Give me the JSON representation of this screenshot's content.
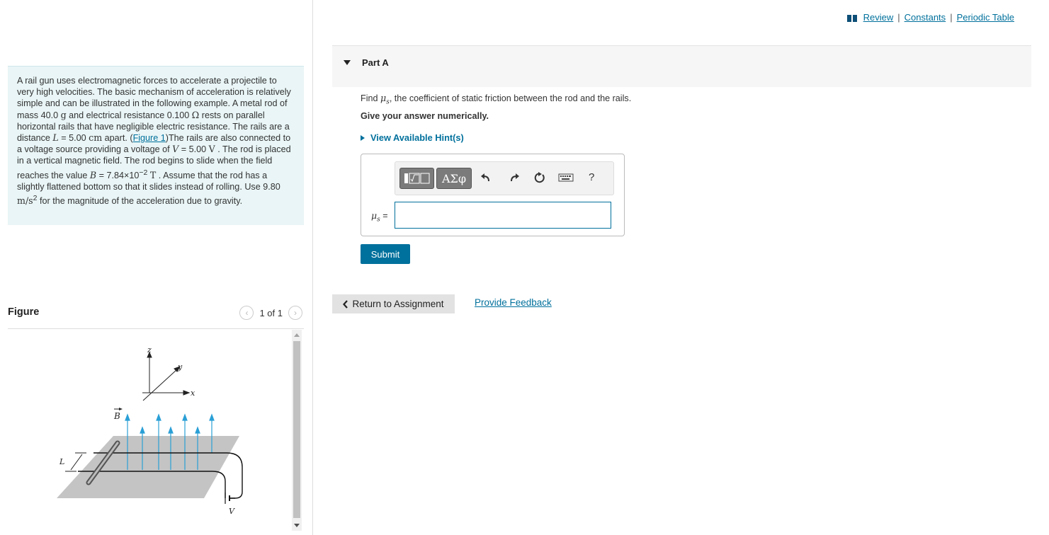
{
  "intro": {
    "t1": "A rail gun uses electromagnetic forces to accelerate a projectile to very high velocities. The basic mechanism of acceleration is relatively simple and can be illustrated in the following example. A metal rod of mass 40.0 ",
    "u_g": "g",
    "t2": " and electrical resistance 0.100 ",
    "u_ohm": "Ω",
    "t3": " rests on parallel horizontal rails that have negligible electric resistance. The rails are a distance ",
    "sym_L": "L",
    "t4": " = 5.00 ",
    "u_cm": "cm",
    "t5": " apart. (",
    "fig_link": "Figure 1",
    "t6": ")The rails are also connected to a voltage source providing a voltage of ",
    "sym_V": "V",
    "t7": " = 5.00 ",
    "u_V": "V",
    "t8": " . The rod is placed in a vertical magnetic field. The rod begins to slide when the field reaches the value ",
    "sym_B": "B",
    "t9": " = 7.84×10",
    "exp": "−2",
    "u_T": "T",
    "t10": " . Assume that the rod has a slightly flattened bottom so that it slides instead of rolling. Use 9.80 ",
    "u_ms2": "m/s",
    "sq": "2",
    "t11": " for the magnitude of the acceleration due to gravity."
  },
  "figure": {
    "title": "Figure",
    "pager": "1 of 1",
    "prev_icon": "chevron-left-icon",
    "next_icon": "chevron-right-icon",
    "labels": {
      "z": "z",
      "y": "y",
      "x": "x",
      "B": "B",
      "L": "L",
      "V": "V"
    },
    "field_color": "#2a9fd6",
    "plane_color": "#c4c4c4"
  },
  "toplinks": {
    "review": "Review",
    "constants": "Constants",
    "periodic": "Periodic Table",
    "sep": "|"
  },
  "part": {
    "title": "Part A"
  },
  "question": {
    "find": "Find ",
    "mu": "μ",
    "sub": "s",
    "rest": ", the coefficient of static friction between the rod and the rails.",
    "instruction": "Give your answer numerically.",
    "hints": "View Available Hint(s)"
  },
  "toolbar": {
    "greek": "ΑΣφ",
    "icons": [
      "templates-icon",
      "greek-symbols-icon",
      "undo-icon",
      "redo-icon",
      "reset-icon",
      "keyboard-icon",
      "help-icon"
    ],
    "help": "?"
  },
  "answer": {
    "label_mu": "μ",
    "label_sub": "s",
    "label_eq": " =",
    "value": ""
  },
  "buttons": {
    "submit": "Submit",
    "return": "Return to Assignment",
    "feedback": "Provide Feedback"
  },
  "colors": {
    "accent": "#00709c",
    "intro_bg": "#e9f5f6"
  }
}
